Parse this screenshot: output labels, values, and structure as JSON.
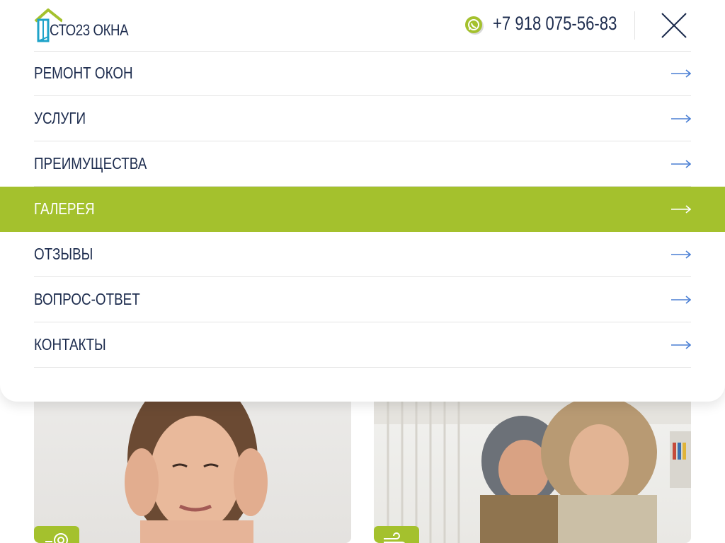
{
  "header": {
    "logo_text": "СТО23 ОКНА",
    "phone": "+7 918 075-56-83"
  },
  "menu": {
    "items": [
      {
        "label": "РЕМОНТ ОКОН",
        "active": false
      },
      {
        "label": "УСЛУГИ",
        "active": false
      },
      {
        "label": "ПРЕИМУЩЕСТВА",
        "active": false
      },
      {
        "label": "ГАЛЕРЕЯ",
        "active": true
      },
      {
        "label": "ОТЗЫВЫ",
        "active": false
      },
      {
        "label": "ВОПРОС-ОТВЕТ",
        "active": false
      },
      {
        "label": "КОНТАКТЫ",
        "active": false
      }
    ]
  },
  "icons": {
    "logo": "window-house-logo",
    "whatsapp": "whatsapp-icon",
    "close": "close-icon",
    "arrow": "arrow-right-icon"
  },
  "colors": {
    "accent_green": "#a4c12d",
    "text_navy": "#1d2c4e",
    "arrow_blue": "#4a7fd4",
    "logo_teal": "#1fa3c9"
  }
}
